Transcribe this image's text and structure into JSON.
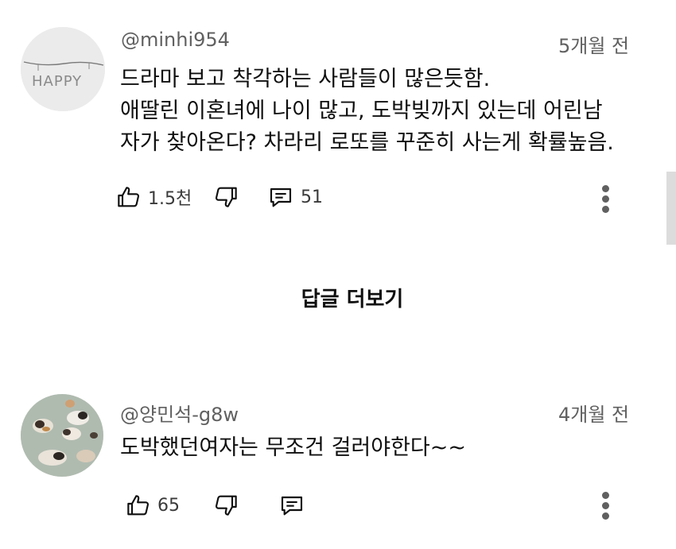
{
  "comments": [
    {
      "author": "@minhi954",
      "time": "5개월 전",
      "avatar_text": "HAPPY",
      "lines": [
        "드라마 보고 착각하는 사람들이 많은듯함.",
        "애딸린 이혼녀에 나이 많고, 도박빚까지 있는데 어린남",
        "자가 찾아온다? 차라리 로또를 꾸준히 사는게 확률높음."
      ],
      "likes": "1.5천",
      "replies_count": "51"
    },
    {
      "author": "@양민석-g8w",
      "time": "4개월 전",
      "lines": [
        "도박했던여자는 무조건 걸러야한다~~"
      ],
      "likes": "65"
    }
  ],
  "view_replies_label": "답글 더보기",
  "icons": {
    "like": "thumbs-up-icon",
    "dislike": "thumbs-down-icon",
    "reply": "comment-icon",
    "more": "more-vertical-icon"
  },
  "colors": {
    "text": "#0f0f0f",
    "secondary": "#606060",
    "background": "#ffffff"
  }
}
